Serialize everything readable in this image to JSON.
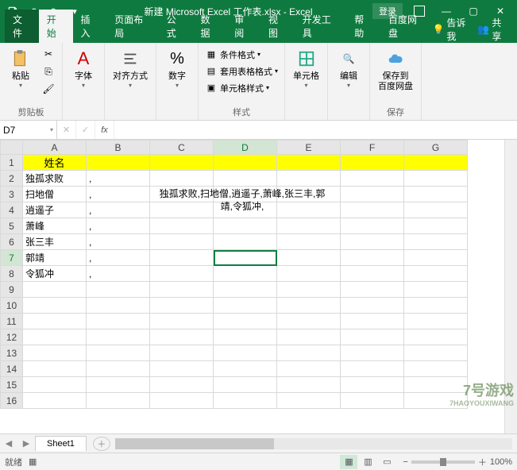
{
  "title": "新建 Microsoft Excel 工作表.xlsx - Excel",
  "login_label": "登录",
  "tabs": {
    "file": "文件",
    "home": "开始",
    "insert": "插入",
    "layout": "页面布局",
    "formulas": "公式",
    "data": "数据",
    "review": "审阅",
    "view": "视图",
    "dev": "开发工具",
    "help": "帮助",
    "baidu": "百度网盘",
    "tellme": "告诉我",
    "share": "共享"
  },
  "ribbon": {
    "clipboard": {
      "paste": "粘贴",
      "label": "剪贴板"
    },
    "font": {
      "btn": "字体"
    },
    "align": {
      "btn": "对齐方式"
    },
    "number": {
      "btn": "数字"
    },
    "styles": {
      "cond": "条件格式",
      "tablefmt": "套用表格格式",
      "cellstyle": "单元格样式",
      "label": "样式"
    },
    "cells": {
      "btn": "单元格"
    },
    "edit": {
      "btn": "编辑"
    },
    "save": {
      "btn": "保存到\n百度网盘",
      "label": "保存"
    }
  },
  "namebox": "D7",
  "formula": "",
  "columns": [
    "A",
    "B",
    "C",
    "D",
    "E",
    "F",
    "G"
  ],
  "rows": [
    "1",
    "2",
    "3",
    "4",
    "5",
    "6",
    "7",
    "8",
    "9",
    "10",
    "11",
    "12",
    "13",
    "14",
    "15",
    "16"
  ],
  "cells": {
    "A1": "姓名",
    "A2": "独孤求败",
    "B2": ",",
    "A3": "扫地僧",
    "B3": ",",
    "A4": "逍遥子",
    "B4": ",",
    "A5": "萧峰",
    "B5": ",",
    "A6": "张三丰",
    "B6": ",",
    "A7": "郭靖",
    "B7": ",",
    "A8": "令狐冲",
    "B8": ","
  },
  "merged_text": "独孤求败,扫地僧,逍遥子,萧峰,张三丰,郭靖,令狐冲,",
  "selected_cell": "D7",
  "sheet_tab": "Sheet1",
  "status": {
    "ready": "就绪",
    "zoom": "100%"
  },
  "watermark": {
    "main": "7号游戏",
    "sub": "7HAOYOUXIWANG"
  },
  "colors": {
    "accent": "#0f7a3f",
    "highlight": "#ffff00",
    "selection": "#107c41"
  }
}
